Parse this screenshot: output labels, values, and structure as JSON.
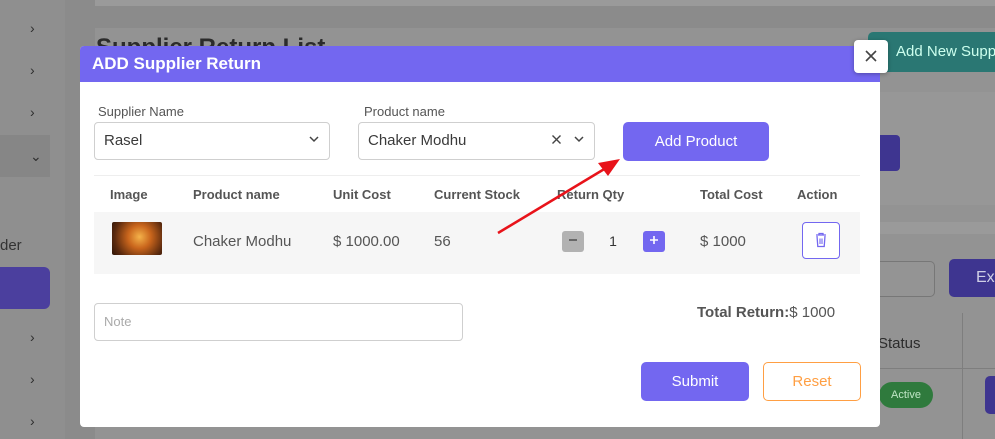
{
  "background": {
    "sidebar_label": "der",
    "page_title": "Supplier Return List",
    "add_new_label": "Add New Supp",
    "ex_label": "Ex",
    "status_header": "Status",
    "status_badge": "Active"
  },
  "modal": {
    "title": "ADD Supplier Return",
    "close_glyph": "×",
    "supplier": {
      "label": "Supplier Name",
      "value": "Rasel"
    },
    "product": {
      "label": "Product name",
      "value": "Chaker Modhu"
    },
    "add_product_label": "Add Product",
    "table": {
      "headers": [
        "Image",
        "Product name",
        "Unit Cost",
        "Current Stock",
        "Return Qty",
        "Total Cost",
        "Action"
      ],
      "rows": [
        {
          "product_name": "Chaker Modhu",
          "unit_cost": "$ 1000.00",
          "current_stock": "56",
          "return_qty": "1",
          "total_cost": "$ 1000"
        }
      ]
    },
    "note_placeholder": "Note",
    "total_return_label": "Total Return:",
    "total_return_value": "$ 1000",
    "submit_label": "Submit",
    "reset_label": "Reset"
  },
  "colors": {
    "primary": "#7367f0",
    "reset": "#ff9f43",
    "annotation_arrow": "#e8131a"
  },
  "icons": [
    "chevron-right-icon",
    "chevron-down-icon",
    "clear-icon",
    "minus-icon",
    "plus-icon",
    "trash-icon",
    "close-icon"
  ]
}
